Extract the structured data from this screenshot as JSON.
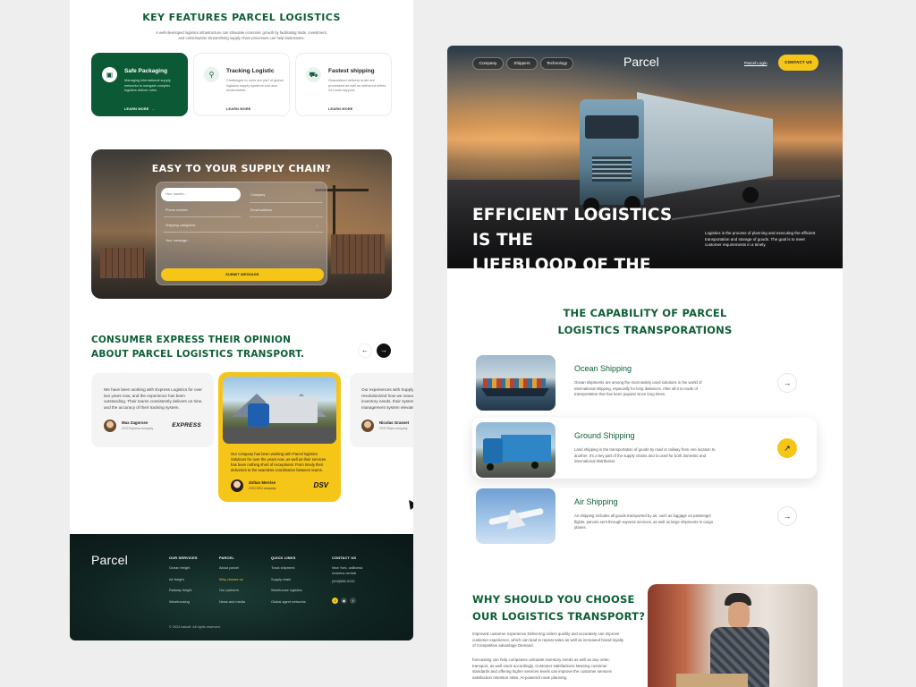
{
  "features": {
    "title": "KEY FEATURES PARCEL LOGISTICS",
    "subtitle": "A well-developed logistics infrastructure can stimulate economic growth by facilitating trade, investment, and consumption Streamlining supply chain processes can help businesses.",
    "cards": [
      {
        "title": "Safe Packaging",
        "desc": "Managing international supply networks to navigate complex logistics deliver rules.",
        "link": "LEARN MORE",
        "icon": "package-icon"
      },
      {
        "title": "Tracking Logistic",
        "desc": "Challenges to rules are part of global logistics supply systems and also environment.",
        "link": "LEARN MORE",
        "icon": "location-pin-icon"
      },
      {
        "title": "Fastest shipping",
        "desc": "Guaranteed delivery order are processed as well as delivered within 24 hours support.",
        "link": "LEARN MORE",
        "icon": "truck-icon"
      }
    ]
  },
  "supply_form": {
    "title": "EASY TO YOUR SUPPLY CHAIN?",
    "name_placeholder": "Your names...",
    "company_placeholder": "Company",
    "phone_placeholder": "Phone number",
    "email_placeholder": "Email address",
    "category_placeholder": "Shipping categories",
    "message_placeholder": "Your message...",
    "submit_label": "SUBMIT MESSAGE"
  },
  "opinions": {
    "title_line1": "CONSUMER EXPRESS THEIR OPINION",
    "title_line2": "ABOUT PARCEL LOGISTICS TRANSPORT.",
    "prev_icon": "←",
    "next_icon": "→",
    "items": [
      {
        "quote": "We have been working with Express Logistics for over two years now, and the experience has been outstanding. Their teams consistently delivers on time, and the accuracy of their tracking system.",
        "name": "Max Zagorsse",
        "role": "CEO Express company",
        "brand": "EXPRESS"
      },
      {
        "quote": "Our company has been working with Parcel logistics Solutions for over the years now, as well as their services has been nothing short of exceptional. From timely their deliveries to the seamless coordination between teams.",
        "name": "Zoltan Merrise",
        "role": "COO DSV company",
        "brand": "DSV"
      },
      {
        "quote": "Our experiences with Supply Express has revolutionized how we manage our logistics, their inventory needs. their system also features management system elevates us.",
        "name": "Nicolas Grasset",
        "role": "CEO Ships company"
      }
    ]
  },
  "footer": {
    "logo": "Parcel",
    "columns": [
      {
        "heading": "OUR SERVICES",
        "items": [
          "Ocean freight",
          "Air freight",
          "Railway freight",
          "Warehousing"
        ]
      },
      {
        "heading": "PARCEL",
        "items": [
          "About parcel",
          "Why choose us",
          "Our partners",
          "News and media"
        ]
      },
      {
        "heading": "QUICK LINKS",
        "items": [
          "Track shipment",
          "Supply chain",
          "Warehouse logistics",
          "Global agent networks"
        ]
      },
      {
        "heading": "CONTACT US",
        "items": [
          "New York, california",
          "America central",
          "(404)555-0132"
        ]
      }
    ],
    "copyright": "© 2024 kalsoft. All rights reserved."
  },
  "hero": {
    "nav": [
      "Company",
      "Shippers",
      "Technology"
    ],
    "brand": "Parcel",
    "login": "Parcel Login",
    "cta": "CONTACT US",
    "headline_line1": "EFFICIENT LOGISTICS IS THE",
    "headline_line2": "LIFEBLOOD OF THE ECONOMY",
    "desc": "Logistics is the process of planning and executing the efficient transportation and storage of goods. The goal is to meet customer requirements in a timely."
  },
  "capability": {
    "title_line1": "THE CAPABILITY OF PARCEL",
    "title_line2": "LOGISTICS TRANSPORATIONS",
    "services": [
      {
        "title": "Ocean Shipping",
        "desc": "Ocean shipments are among the most widely used solutions in the world of international shipping, especially for long distances. After all it is mode of transportation that has been popular since long times.",
        "icon": "arrow-icon"
      },
      {
        "title": "Ground Shipping",
        "desc": "Land shipping is the transportation of goods by road or railway from one location to another. It's a key part of the supply chains and is used for both domestic and international distribution.",
        "icon": "arrow-up-right-icon"
      },
      {
        "title": "Air Shipping",
        "desc": "Air shipping includes all goods transported by air, such as luggage on passenger flights, parcels sent through express services, as well as large shipments in cargo planes.",
        "icon": "arrow-icon"
      }
    ]
  },
  "why": {
    "title_line1": "WHY SHOULD YOU CHOOSE",
    "title_line2": "OUR LOGISTICS TRANSPORT?",
    "p1": "Improved customer experience Delivering orders quickly and accurately can improve customer experience, which can lead to repeat sales as well as increased brand loyalty of Competitive advantage Demand.",
    "p2": "forecasting can help companies calculate inventory needs as well as any order, transport, as well stock accordingly. Customer satisfactions Meeting customer standards and offering higher services levels can improve the customer services satisfaction retention rates. AI-powered route planning."
  },
  "colors": {
    "brand_green": "#0d5e36",
    "accent_yellow": "#f5c518",
    "footer_dark": "#0f2320"
  }
}
